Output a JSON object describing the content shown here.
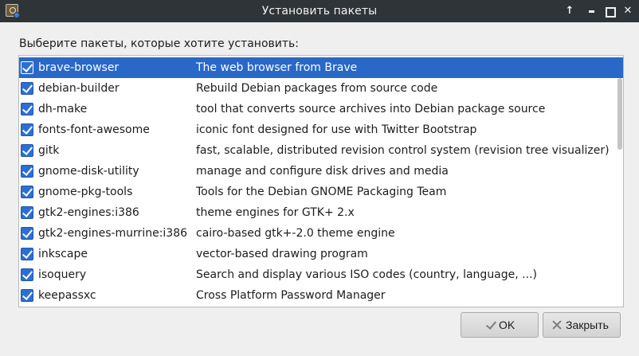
{
  "window": {
    "title": "Установить пакеты",
    "buttons": [
      "arrow-up-icon",
      "minimize-icon",
      "maximize-icon",
      "close-icon"
    ]
  },
  "prompt": "Выберите пакеты, которые хотите установить:",
  "packages": [
    {
      "name": "brave-browser",
      "description": "The web browser from Brave",
      "checked": true,
      "selected": true
    },
    {
      "name": "debian-builder",
      "description": "Rebuild Debian packages from source code",
      "checked": true,
      "selected": false
    },
    {
      "name": "dh-make",
      "description": "tool that converts source archives into Debian package source",
      "checked": true,
      "selected": false
    },
    {
      "name": "fonts-font-awesome",
      "description": "iconic font designed for use with Twitter Bootstrap",
      "checked": true,
      "selected": false
    },
    {
      "name": "gitk",
      "description": "fast, scalable, distributed revision control system (revision tree visualizer)",
      "checked": true,
      "selected": false
    },
    {
      "name": "gnome-disk-utility",
      "description": "manage and configure disk drives and media",
      "checked": true,
      "selected": false
    },
    {
      "name": "gnome-pkg-tools",
      "description": "Tools for the Debian GNOME Packaging Team",
      "checked": true,
      "selected": false
    },
    {
      "name": "gtk2-engines:i386",
      "description": "theme engines for GTK+ 2.x",
      "checked": true,
      "selected": false
    },
    {
      "name": "gtk2-engines-murrine:i386",
      "description": "cairo-based gtk+-2.0 theme engine",
      "checked": true,
      "selected": false
    },
    {
      "name": "inkscape",
      "description": "vector-based drawing program",
      "checked": true,
      "selected": false
    },
    {
      "name": "isoquery",
      "description": "Search and display various ISO codes (country, language, ...)",
      "checked": true,
      "selected": false
    },
    {
      "name": "keepassxc",
      "description": "Cross Platform Password Manager",
      "checked": true,
      "selected": false
    }
  ],
  "buttons": {
    "ok_label": "OK",
    "close_label": "Закрыть"
  },
  "colors": {
    "selection": "#2a68c8",
    "checkbox": "#2d6fd1",
    "titlebar": "#2f3438"
  }
}
